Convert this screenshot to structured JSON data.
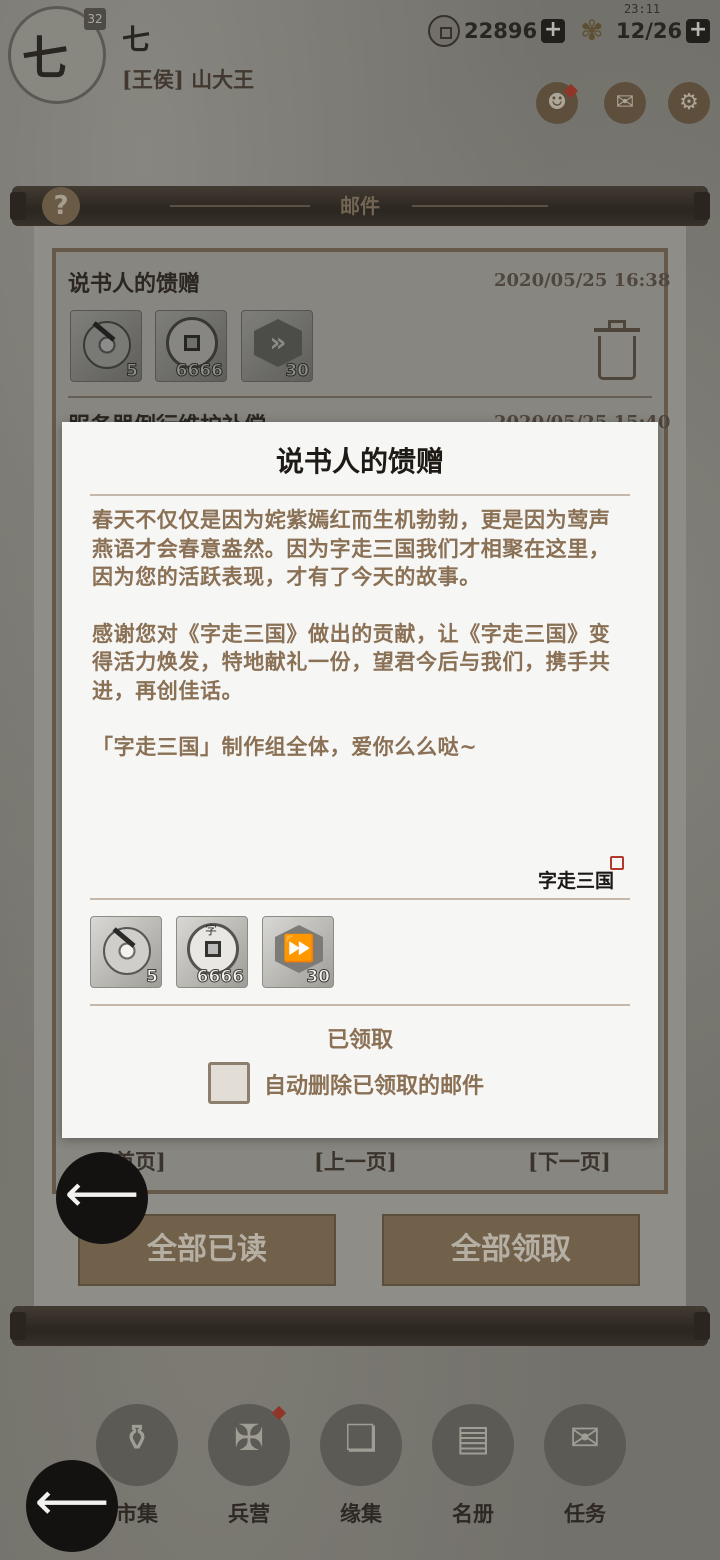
{
  "player": {
    "avatar_char": "七",
    "level": "32",
    "name": "七",
    "title": "[王侯] 山大王"
  },
  "status": {
    "clock": "23:11",
    "coins": "22896",
    "stamina": "12/26",
    "plus": "+"
  },
  "icons": {
    "help": "?",
    "friends": "friends-icon",
    "mail": "mail-icon",
    "settings": "gear-icon"
  },
  "panel": {
    "title": "邮件"
  },
  "mail_list": [
    {
      "title": "说书人的馈赠",
      "date": "2020/05/25 16:38",
      "rewards": [
        {
          "type": "disc",
          "qty": "5"
        },
        {
          "type": "coin",
          "qty": "6666"
        },
        {
          "type": "fast-forward",
          "qty": "30"
        }
      ]
    },
    {
      "title": "服务器例行维护补偿",
      "date": "2020/05/25 15:40"
    }
  ],
  "pagination": {
    "first": "[首页]",
    "prev": "[上一页]",
    "next": "[下一页]"
  },
  "actions": {
    "read_all": "全部已读",
    "claim_all": "全部领取"
  },
  "bottom_nav": [
    {
      "label": "市集",
      "glyph": "⚱"
    },
    {
      "label": "兵营",
      "glyph": "✠"
    },
    {
      "label": "缘集",
      "glyph": "❏"
    },
    {
      "label": "名册",
      "glyph": "▤"
    },
    {
      "label": "任务",
      "glyph": "✉"
    }
  ],
  "modal": {
    "title": "说书人的馈赠",
    "paragraphs": [
      "春天不仅仅是因为姹紫嫣红而生机勃勃，更是因为莺声燕语才会春意盎然。因为字走三国我们才相聚在这里，因为您的活跃表现，才有了今天的故事。",
      "感谢您对《字走三国》做出的贡献，让《字走三国》变得活力焕发，特地献礼一份，望君今后与我们，携手共进，再创佳话。",
      "「字走三国」制作组全体，爱你么么哒~"
    ],
    "signature": "字走三国",
    "rewards": [
      {
        "type": "disc",
        "qty": "5"
      },
      {
        "type": "coin",
        "qty": "6666",
        "glyph": "字"
      },
      {
        "type": "fast-forward",
        "qty": "30",
        "glyph": "⏩"
      }
    ],
    "claimed_label": "已领取",
    "auto_delete_label": "自动删除已领取的邮件",
    "auto_delete_checked": false
  },
  "back_glyph": "⟵"
}
